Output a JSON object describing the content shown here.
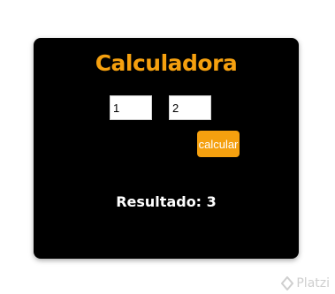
{
  "app": {
    "title": "Calculadora"
  },
  "inputs": {
    "first_value": "1",
    "second_value": "2"
  },
  "button": {
    "label": "calcular"
  },
  "result": {
    "text": "Resultado: 3"
  },
  "watermark": {
    "text": "Platzi",
    "icon": "platzi-logo-icon"
  },
  "colors": {
    "accent": "#f5a00f",
    "card_background": "#000000",
    "result_text": "#ffffff"
  }
}
